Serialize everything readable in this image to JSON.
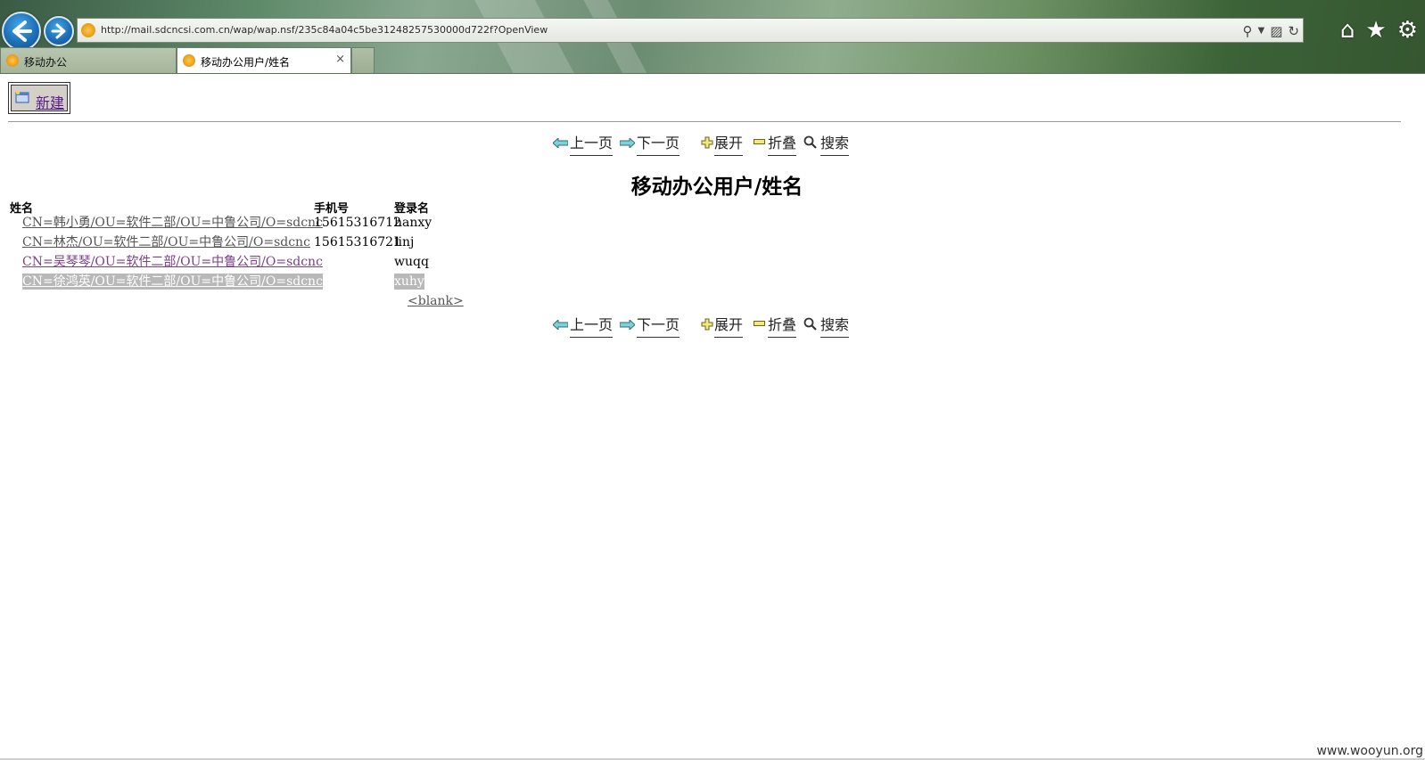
{
  "browser": {
    "url": "http://mail.sdcncsi.com.cn/wap/wap.nsf/235c84a04c5be31248257530000d722f?OpenView",
    "tabs": [
      {
        "label": "移动办公",
        "active": false
      },
      {
        "label": "移动办公用户/姓名",
        "active": true
      }
    ],
    "tab_close_glyph": "×",
    "icons": [
      "back-icon",
      "forward-icon",
      "page-icon",
      "search-icon",
      "dropdown-icon",
      "compat-icon",
      "refresh-icon",
      "home-icon",
      "favorites-icon",
      "settings-icon"
    ]
  },
  "toolbar": {
    "new_label": "新建"
  },
  "actions_top": {
    "prev": "上一页",
    "next": "下一页",
    "expand": "展开",
    "collapse": "折叠",
    "search": "搜索"
  },
  "actions_bottom": {
    "prev": "上一页",
    "next": "下一页",
    "expand": "展开",
    "collapse": "折叠",
    "search": "搜索"
  },
  "view": {
    "title": "移动办公用户/姓名",
    "columns": [
      "姓名",
      "手机号",
      "登录名"
    ],
    "rows": [
      {
        "name": "CN=韩小勇/OU=软件二部/OU=中鲁公司/O=sdcnc",
        "phone": "15615316712",
        "login": "hanxy",
        "state": "normal"
      },
      {
        "name": "CN=林杰/OU=软件二部/OU=中鲁公司/O=sdcnc",
        "phone": "15615316721",
        "login": "linj",
        "state": "normal"
      },
      {
        "name": "CN=吴琴琴/OU=软件二部/OU=中鲁公司/O=sdcnc",
        "phone": "",
        "login": "wuqq",
        "state": "visited"
      },
      {
        "name": "CN=徐鸿英/OU=软件二部/OU=中鲁公司/O=sdcnc",
        "phone": "",
        "login": "xuhy",
        "state": "selected"
      }
    ],
    "blank_row": "<blank>"
  },
  "watermark": "www.wooyun.org",
  "colors": {
    "visited_link": "#7b3f8a",
    "link": "#555555",
    "selected_bg": "#b8b8b8"
  }
}
